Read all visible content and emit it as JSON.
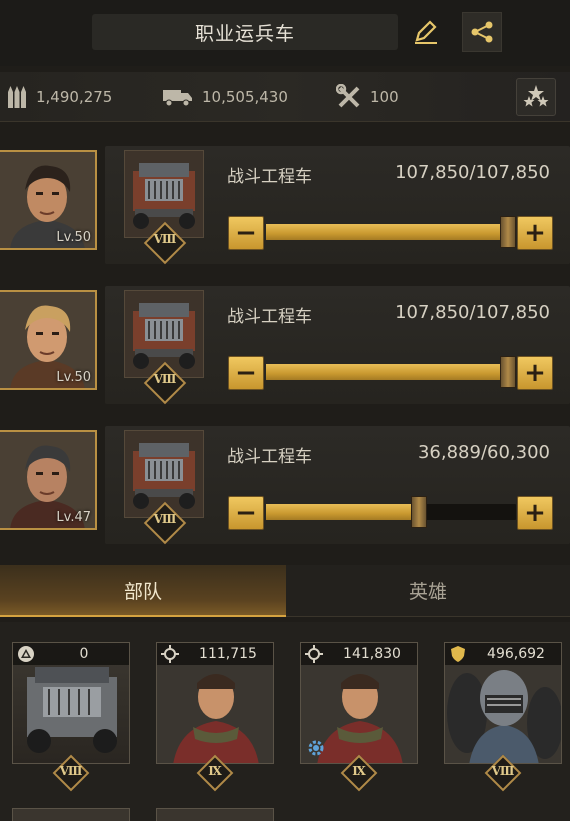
{
  "header": {
    "title": "职业运兵车"
  },
  "resources": {
    "ammo": "1,490,275",
    "transport": "10,505,430",
    "repair": "100"
  },
  "vehicles": [
    {
      "hero_level": "Lv.50",
      "name": "战斗工程车",
      "count": "107,850/107,850",
      "rank": "Ⅷ",
      "fill_fraction": 1.0
    },
    {
      "hero_level": "Lv.50",
      "name": "战斗工程车",
      "count": "107,850/107,850",
      "rank": "Ⅷ",
      "fill_fraction": 1.0
    },
    {
      "hero_level": "Lv.47",
      "name": "战斗工程车",
      "count": "36,889/60,300",
      "rank": "Ⅷ",
      "fill_fraction": 0.61
    }
  ],
  "tabs": {
    "troops": "部队",
    "heroes": "英雄"
  },
  "units": [
    {
      "icon": "triangle-badge-icon",
      "value": "0",
      "rank": "Ⅷ"
    },
    {
      "icon": "crosshair-icon",
      "value": "111,715",
      "rank": "Ⅸ"
    },
    {
      "icon": "crosshair-icon",
      "value": "141,830",
      "rank": "Ⅸ"
    },
    {
      "icon": "shield-icon",
      "value": "496,692",
      "rank": "Ⅷ"
    }
  ],
  "colors": {
    "accent": "#d5a340",
    "background": "#1f1d19"
  }
}
